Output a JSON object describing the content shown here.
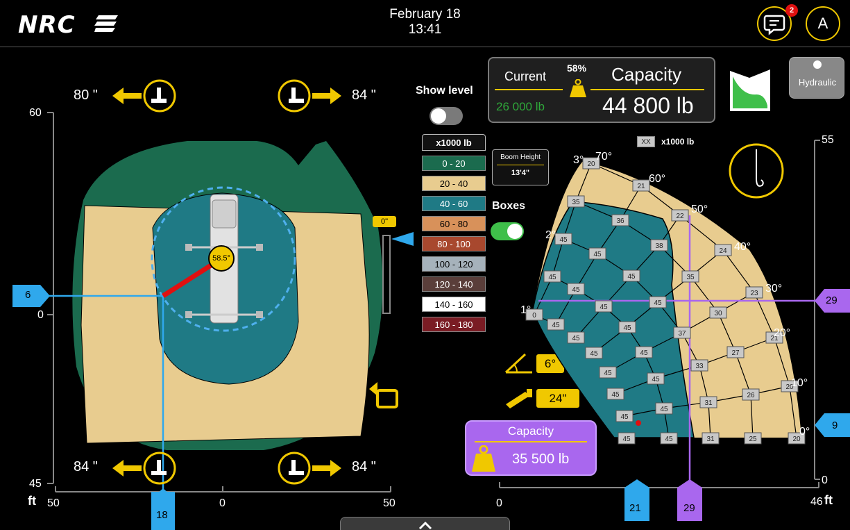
{
  "header": {
    "logo_text": "NRC",
    "date": "February 18",
    "time": "13:41",
    "messages_badge": "2",
    "user_initial": "A"
  },
  "outriggers": {
    "front_left": "80 \"",
    "front_right": "84 \"",
    "rear_left": "84 \"",
    "rear_right": "84 \""
  },
  "left_plot": {
    "y_top": "60",
    "y_zero": "0",
    "y_bottom": "45",
    "x_left": "50",
    "x_mid": "0",
    "x_right": "50",
    "unit": "ft",
    "marker_left": "6",
    "marker_bottom": "18",
    "swing_angle": "58.5°",
    "level_indicator": "0\""
  },
  "controls": {
    "show_level_label": "Show level",
    "boxes_label": "Boxes",
    "boom_height_label": "Boom Height",
    "boom_height_value": "13'4\"",
    "angle_value": "6°",
    "extension_value": "24\"",
    "show_level_on": false,
    "boxes_on": true
  },
  "legend": {
    "header": "x1000 lb",
    "items": [
      {
        "label": "0 - 20",
        "color": "#1b6b4e",
        "text": "#fff"
      },
      {
        "label": "20 - 40",
        "color": "#e8cc8f",
        "text": "#000"
      },
      {
        "label": "40 - 60",
        "color": "#1f7a85",
        "text": "#fff"
      },
      {
        "label": "60 - 80",
        "color": "#d8915a",
        "text": "#000"
      },
      {
        "label": "80 - 100",
        "color": "#a8482e",
        "text": "#fff"
      },
      {
        "label": "100 - 120",
        "color": "#a6b2bb",
        "text": "#000"
      },
      {
        "label": "120 - 140",
        "color": "#5a3e3a",
        "text": "#fff"
      },
      {
        "label": "140 - 160",
        "color": "#ffffff",
        "text": "#000"
      },
      {
        "label": "160 - 180",
        "color": "#7a1c24",
        "text": "#fff"
      }
    ]
  },
  "capacity_panel": {
    "current_label": "Current",
    "current_value": "26 000 lb",
    "percent": "58%",
    "capacity_label": "Capacity",
    "capacity_value": "44 800 lb"
  },
  "hydraulic_label": "Hydraulic",
  "purple_capacity": {
    "label": "Capacity",
    "value": "35 500 lb"
  },
  "right_plot": {
    "units_label": "x1000 lb",
    "units_box": "XX",
    "y_top": "55",
    "y_bottom": "0",
    "x_left": "0",
    "x_right": "46",
    "unit": "ft",
    "marker_right": "29",
    "marker_right_low": "9",
    "marker_bottom_1": "21",
    "marker_bottom_2": "29",
    "angles": [
      "70°",
      "60°",
      "50°",
      "40°",
      "30°",
      "20°",
      "10°",
      "0°",
      "1°",
      "2°",
      "3°"
    ],
    "boxes": [
      "20",
      "21",
      "35",
      "36",
      "22",
      "45",
      "38",
      "24",
      "45",
      "45",
      "45",
      "45",
      "35",
      "23",
      "45",
      "45",
      "0",
      "30",
      "45",
      "45",
      "37",
      "45",
      "21",
      "45",
      "45",
      "27",
      "33",
      "45",
      "45",
      "45",
      "20",
      "26",
      "31",
      "45",
      "45",
      "45",
      "45",
      "31",
      "25",
      "20"
    ]
  }
}
